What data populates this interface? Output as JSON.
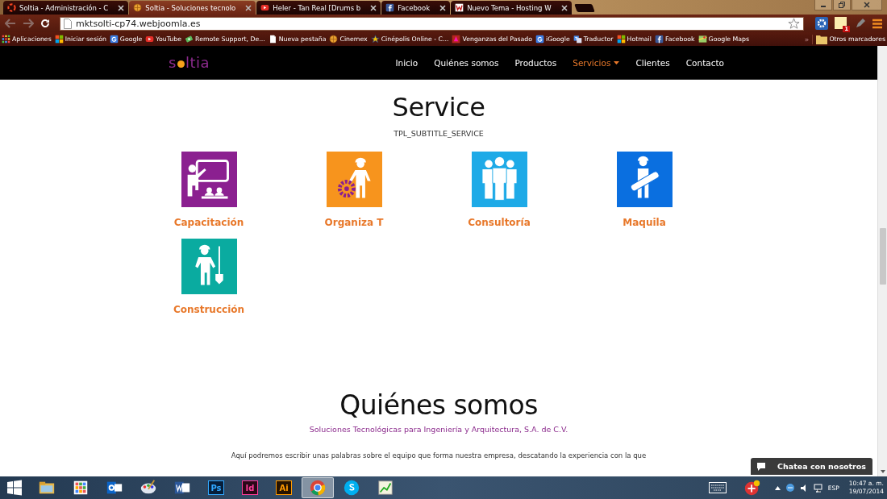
{
  "browser": {
    "tabs": [
      {
        "title": "Soltia - Administración - C",
        "selected": false
      },
      {
        "title": "Soltia - Soluciones tecnolo",
        "selected": true
      },
      {
        "title": "Heler - Tan Real [Drums b",
        "selected": false
      },
      {
        "title": "Facebook",
        "selected": false
      },
      {
        "title": "Nuevo Tema - Hosting W",
        "selected": false
      }
    ],
    "address": "mktsolti-cp74.webjoomla.es",
    "extension_badge": "1",
    "bookmarks": [
      {
        "label": "Aplicaciones"
      },
      {
        "label": "Iniciar sesión"
      },
      {
        "label": "Google"
      },
      {
        "label": "YouTube"
      },
      {
        "label": "Remote Support, De..."
      },
      {
        "label": "Nueva pestaña"
      },
      {
        "label": "Cinemex"
      },
      {
        "label": "Cinépolis Online - C..."
      },
      {
        "label": "Venganzas del Pasado"
      },
      {
        "label": "iGoogle"
      },
      {
        "label": "Traductor"
      },
      {
        "label": "Hotmail"
      },
      {
        "label": "Facebook"
      },
      {
        "label": "Google Maps"
      }
    ],
    "more": "»",
    "other_bookmarks": "Otros marcadores"
  },
  "site": {
    "logo_start": "s",
    "logo_end": "ltia",
    "nav": [
      {
        "label": "Inicio",
        "selected": false,
        "dropdown": false
      },
      {
        "label": "Quiénes somos",
        "selected": false,
        "dropdown": false
      },
      {
        "label": "Productos",
        "selected": false,
        "dropdown": false
      },
      {
        "label": "Servicios",
        "selected": true,
        "dropdown": true
      },
      {
        "label": "Clientes",
        "selected": false,
        "dropdown": false
      },
      {
        "label": "Contacto",
        "selected": false,
        "dropdown": false
      }
    ],
    "service": {
      "title": "Service",
      "subtitle": "TPL_SUBTITLE_SERVICE",
      "items": [
        {
          "label": "Capacitación",
          "color": "#8b2090"
        },
        {
          "label": "Organiza T",
          "color": "#f7941d"
        },
        {
          "label": "Consultoría",
          "color": "#1eaae7"
        },
        {
          "label": "Maquila",
          "color": "#0a6fe0"
        },
        {
          "label": "Construcción",
          "color": "#0aaba0"
        }
      ]
    },
    "about": {
      "title": "Quiénes somos",
      "subtitle": "Soluciones Tecnológicas para Ingeniería y Arquitectura, S.A. de C.V.",
      "text": "Aquí podremos escribir unas palabras sobre el equipo que forma nuestra empresa, descatando la experiencia con la que"
    },
    "chat": "Chatea con nosotros"
  },
  "taskbar": {
    "apps": [
      {
        "selected": false
      },
      {
        "selected": false
      },
      {
        "selected": false
      },
      {
        "selected": false
      },
      {
        "selected": false
      },
      {
        "label": "Ps",
        "selected": false
      },
      {
        "label": "Id",
        "selected": false
      },
      {
        "label": "Ai",
        "selected": false
      },
      {
        "selected": true
      },
      {
        "selected": false
      },
      {
        "selected": false
      }
    ],
    "language": "ESP",
    "time": "10:47 a. m.",
    "date": "19/07/2014"
  }
}
